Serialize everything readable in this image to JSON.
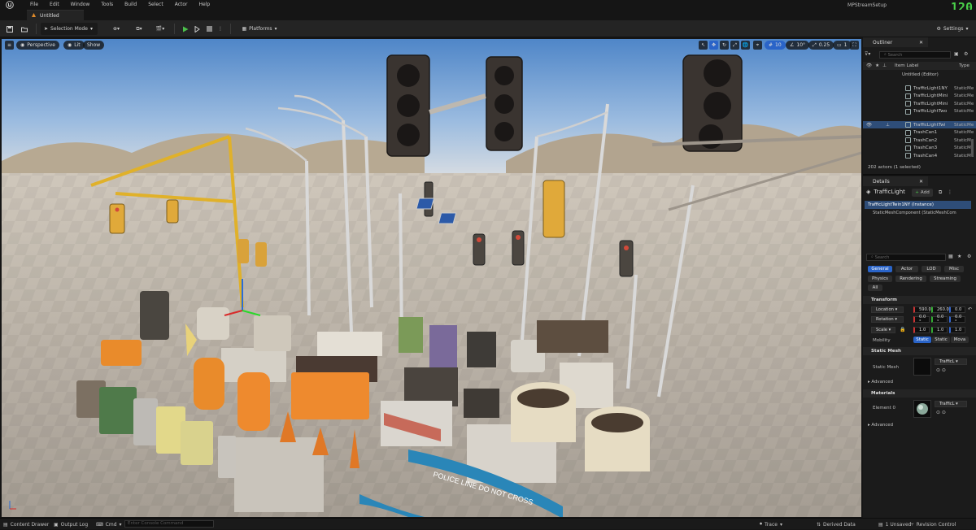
{
  "menu": [
    "File",
    "Edit",
    "Window",
    "Tools",
    "Build",
    "Select",
    "Actor",
    "Help"
  ],
  "document_tab": "Untitled",
  "project_name": "MPStreamSetup",
  "fps": "120",
  "toolbar": {
    "selection_mode": "Selection Mode",
    "platforms": "Platforms",
    "settings": "Settings"
  },
  "viewport": {
    "perspective": "Perspective",
    "lit": "Lit",
    "show": "Show",
    "grid_snap": "10",
    "rot_snap": "10°",
    "scale_snap": "0.25",
    "cam_speed": "1",
    "sign_text": "POLICE LINE DO NOT CROSS"
  },
  "outliner": {
    "tab": "Outliner",
    "search_placeholder": "Search",
    "col_label": "Item Label",
    "col_type": "Type",
    "root": "Untitled (Editor)",
    "rows": [
      {
        "name": "TrafficLight1NY",
        "type": "StaticMe"
      },
      {
        "name": "TrafficLightMini",
        "type": "StaticMe"
      },
      {
        "name": "TrafficLightMini",
        "type": "StaticMe"
      },
      {
        "name": "TrafficLightTwo",
        "type": "StaticMe"
      },
      {
        "name": "TrafficLightTwi",
        "type": "StaticMe"
      },
      {
        "name": "TrashCan1",
        "type": "StaticMe"
      },
      {
        "name": "TrashCan2",
        "type": "StaticMe"
      },
      {
        "name": "TrashCan3",
        "type": "StaticMe"
      },
      {
        "name": "TrashCan4",
        "type": "StaticMe"
      }
    ],
    "status": "202 actors (1 selected)"
  },
  "details": {
    "tab": "Details",
    "actor_name": "TrafficLight",
    "add": "Add",
    "instance": "TrafficLightTwin1NY (Instance)",
    "component": "StaticMeshComponent (StaticMeshCom",
    "search_placeholder": "Search",
    "filters": [
      "General",
      "Actor",
      "LOD",
      "Misc",
      "Physics",
      "Rendering",
      "Streaming",
      "All"
    ],
    "transform": "Transform",
    "location_label": "Location",
    "location": [
      "590.0",
      "260.0",
      "0.0"
    ],
    "rotation_label": "Rotation",
    "rotation": [
      "0.0 °",
      "0.0 °",
      "0.0 °"
    ],
    "scale_label": "Scale",
    "scale": [
      "1.0",
      "1.0",
      "1.0"
    ],
    "mobility_label": "Mobility",
    "mobility": [
      "Static",
      "Static",
      "Mova"
    ],
    "static_mesh_section": "Static Mesh",
    "static_mesh_label": "Static Mesh",
    "static_mesh_value": "TrafficL",
    "advanced": "Advanced",
    "materials_section": "Materials",
    "element_label": "Element 0",
    "element_value": "TrafficL"
  },
  "statusbar": {
    "content_drawer": "Content Drawer",
    "output_log": "Output Log",
    "cmd": "Cmd",
    "console_placeholder": "Enter Console Command",
    "trace": "Trace",
    "derived_data": "Derived Data",
    "unsaved": "1 Unsaved",
    "revision": "Revision Control"
  },
  "colors": {
    "accent": "#2a64c8",
    "selected_row": "#2e4d78",
    "fps": "#4ad14a",
    "play": "#4bbf4b"
  }
}
